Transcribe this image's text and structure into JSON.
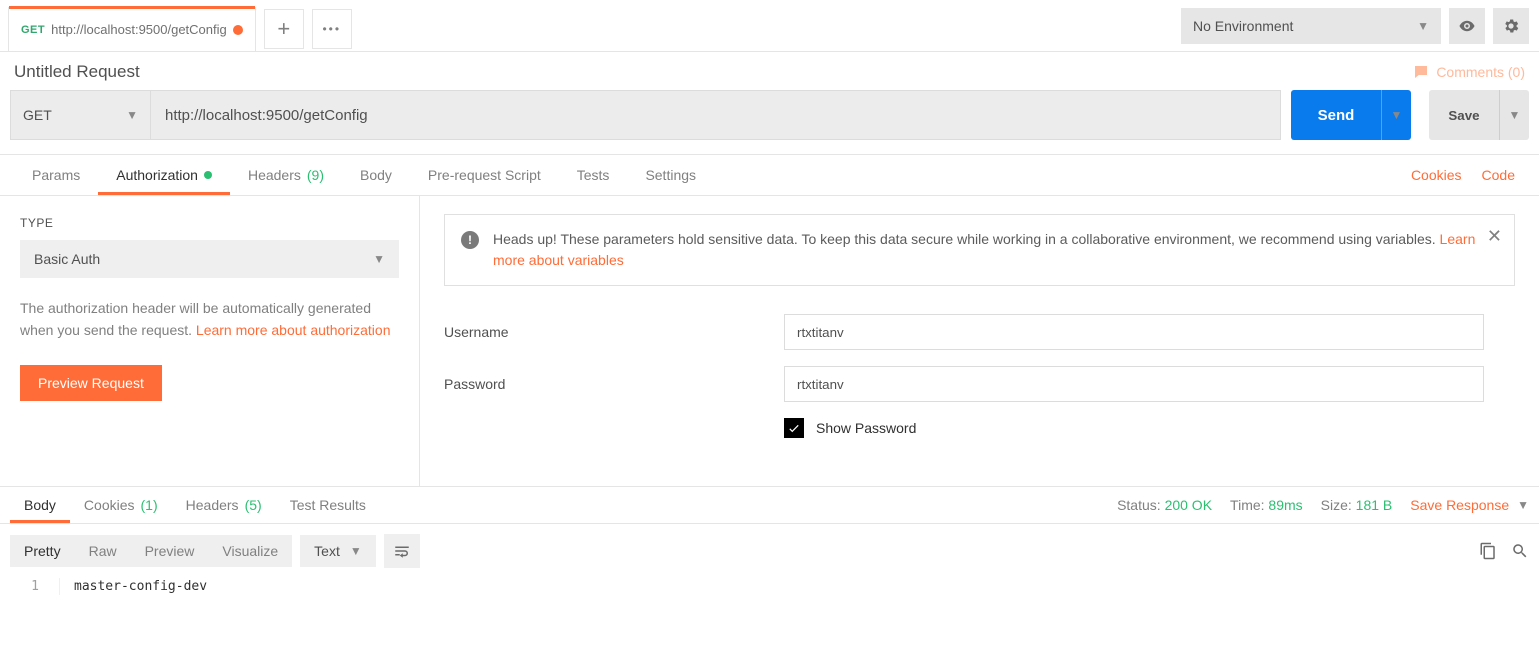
{
  "env": {
    "label": "No Environment"
  },
  "tab": {
    "method": "GET",
    "url": "http://localhost:9500/getConfig"
  },
  "title": "Untitled Request",
  "comments": {
    "label": "Comments (0)"
  },
  "request": {
    "method": "GET",
    "url": "http://localhost:9500/getConfig",
    "send": "Send",
    "save": "Save"
  },
  "reqTabs": {
    "params": "Params",
    "auth": "Authorization",
    "headers": "Headers",
    "headersCount": "(9)",
    "body": "Body",
    "prereq": "Pre-request Script",
    "tests": "Tests",
    "settings": "Settings"
  },
  "rightLinks": {
    "cookies": "Cookies",
    "code": "Code"
  },
  "auth": {
    "typeLabel": "TYPE",
    "typeValue": "Basic Auth",
    "helpText": "The authorization header will be automatically generated when you send the request. ",
    "helpLink": "Learn more about authorization",
    "previewBtn": "Preview Request",
    "bannerText": "Heads up! These parameters hold sensitive data. To keep this data secure while working in a collaborative environment, we recommend using variables. ",
    "bannerLink": "Learn more about variables",
    "usernameLbl": "Username",
    "usernameVal": "rtxtitanv",
    "passwordLbl": "Password",
    "passwordVal": "rtxtitanv",
    "showPassword": "Show Password"
  },
  "respTabs": {
    "body": "Body",
    "cookies": "Cookies",
    "cookiesCount": "(1)",
    "headers": "Headers",
    "headersCount": "(5)",
    "tests": "Test Results"
  },
  "respMeta": {
    "statusLbl": "Status:",
    "statusVal": "200 OK",
    "timeLbl": "Time:",
    "timeVal": "89ms",
    "sizeLbl": "Size:",
    "sizeVal": "181 B",
    "saveResp": "Save Response"
  },
  "respToolbar": {
    "pretty": "Pretty",
    "raw": "Raw",
    "preview": "Preview",
    "visualize": "Visualize",
    "lang": "Text"
  },
  "respBody": {
    "line": "1",
    "content": "master-config-dev"
  }
}
